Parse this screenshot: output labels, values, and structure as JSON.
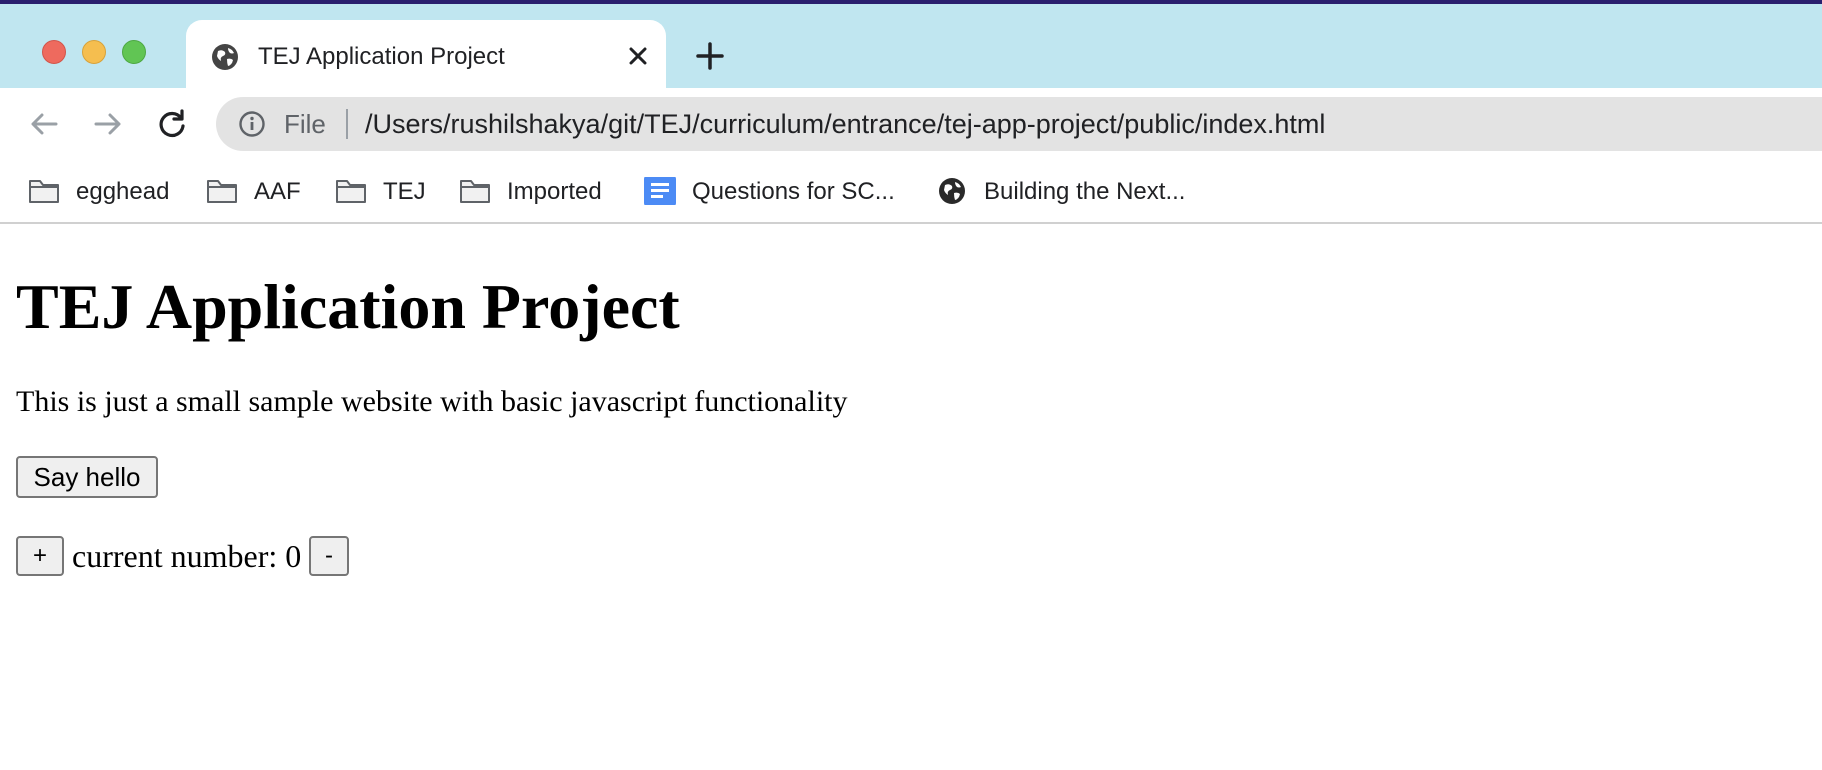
{
  "browser": {
    "tab": {
      "title": "TEJ Application Project"
    },
    "omnibox": {
      "scheme": "File",
      "url": "/Users/rushilshakya/git/TEJ/curriculum/entrance/tej-app-project/public/index.html"
    },
    "bookmarks": [
      {
        "label": "egghead",
        "icon": "folder-icon"
      },
      {
        "label": "AAF",
        "icon": "folder-icon"
      },
      {
        "label": "TEJ",
        "icon": "folder-icon"
      },
      {
        "label": "Imported",
        "icon": "folder-icon"
      },
      {
        "label": "Questions for SC...",
        "icon": "google-docs-icon"
      },
      {
        "label": "Building the Next...",
        "icon": "globe-icon"
      }
    ]
  },
  "page": {
    "heading": "TEJ Application Project",
    "description": "This is just a small sample website with basic javascript functionality",
    "say_hello_label": "Say hello",
    "increment_label": "+",
    "counter_label": "current number: 0",
    "decrement_label": "-"
  },
  "colors": {
    "tabbar_bg": "#c0e6f0",
    "close_red": "#ee6a5e",
    "minimize_yellow": "#f5be4f",
    "zoom_green": "#61c554",
    "docs_blue": "#4c8bf5"
  }
}
